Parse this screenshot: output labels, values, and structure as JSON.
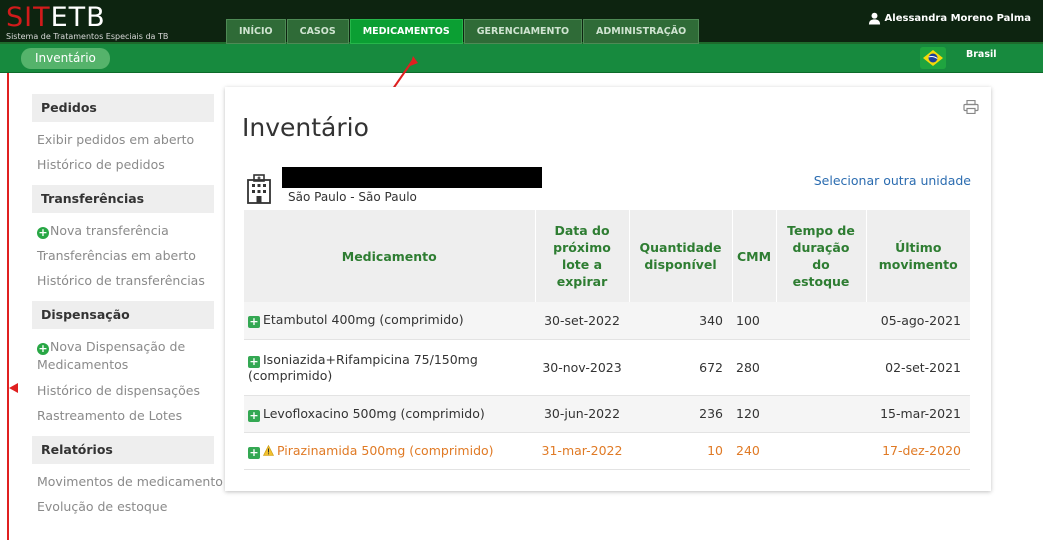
{
  "app": {
    "logo_main_red": "SIT",
    "logo_main_white": "ETB",
    "logo_subtitle": "Sistema de Tratamentos Especiais da TB"
  },
  "nav": {
    "tabs": [
      {
        "label": "INÍCIO"
      },
      {
        "label": "CASOS"
      },
      {
        "label": "MEDICAMENTOS",
        "active": true
      },
      {
        "label": "GERENCIAMENTO"
      },
      {
        "label": "ADMINISTRAÇÃO"
      }
    ]
  },
  "user": {
    "name": "Alessandra Moreno Palma",
    "icon": "user-icon"
  },
  "subbar": {
    "breadcrumb": "Inventário",
    "country": "Brasil",
    "flag_icon": "brazil-flag-icon"
  },
  "sidebar": {
    "sections": [
      {
        "title": "Pedidos",
        "links": [
          "Exibir pedidos em aberto",
          "Histórico de pedidos"
        ]
      },
      {
        "title": "Transferências",
        "links": [
          "Nova transferência",
          "Transferências em aberto",
          "Histórico de transferências"
        ]
      },
      {
        "title": "Dispensação",
        "links": [
          "Nova Dispensação de Medicamentos",
          "Histórico de dispensações",
          "Rastreamento de Lotes"
        ]
      },
      {
        "title": "Relatórios",
        "links": [
          "Movimentos de medicamento",
          "Evolução de estoque"
        ]
      }
    ]
  },
  "main": {
    "title": "Inventário",
    "unit_location": "São Paulo - São Paulo",
    "select_unit_link": "Selecionar outra unidade",
    "print_icon": "printer-icon",
    "table": {
      "headers": [
        "Medicamento",
        "Data do próximo lote a expirar",
        "Quantidade disponível",
        "CMM",
        "Tempo de duração do estoque",
        "Último movimento"
      ],
      "rows": [
        {
          "medicamento": "Etambutol 400mg (comprimido)",
          "data": "30-set-2022",
          "quantidade": "340",
          "cmm": "100",
          "tempo": "",
          "ultimo": "05-ago-2021",
          "warning": false
        },
        {
          "medicamento": "Isoniazida+Rifampicina 75/150mg (comprimido)",
          "data": "30-nov-2023",
          "quantidade": "672",
          "cmm": "280",
          "tempo": "",
          "ultimo": "02-set-2021",
          "warning": false
        },
        {
          "medicamento": "Levofloxacino 500mg (comprimido)",
          "data": "30-jun-2022",
          "quantidade": "236",
          "cmm": "120",
          "tempo": "",
          "ultimo": "15-mar-2021",
          "warning": false
        },
        {
          "medicamento": "Pirazinamida 500mg (comprimido)",
          "data": "31-mar-2022",
          "quantidade": "10",
          "cmm": "240",
          "tempo": "",
          "ultimo": "17-dez-2020",
          "warning": true
        }
      ]
    }
  },
  "colors": {
    "header_dark": "#0d2410",
    "active_tab": "#0b9f33",
    "subbar": "#178a3e",
    "link_blue": "#2b6cb0",
    "warning": "#e07a25",
    "table_header_text": "#2e7d32"
  }
}
